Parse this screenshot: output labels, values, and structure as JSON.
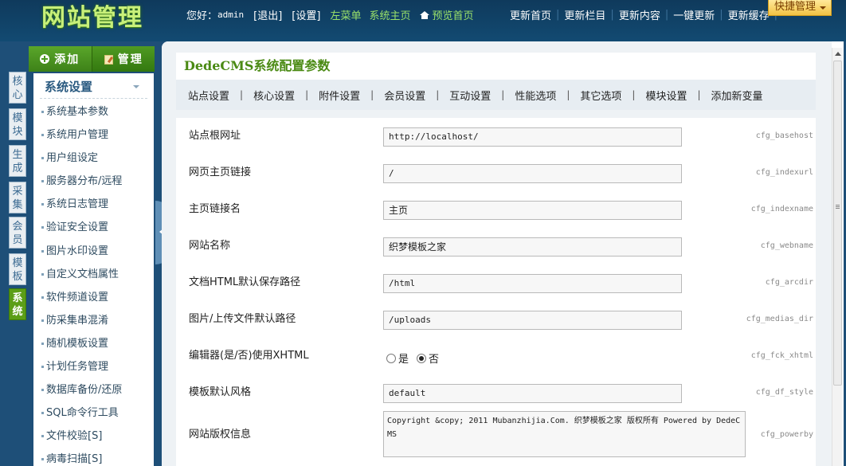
{
  "header": {
    "logo": "网站管理",
    "greeting": "您好：",
    "username": "admin",
    "logout": "[退出]",
    "settings": "[设置]",
    "left_menu": "左菜单",
    "system_home": "系统主页",
    "preview_home": "预览首页",
    "update_links": [
      "更新首页",
      "更新栏目",
      "更新内容",
      "一键更新",
      "更新缓存"
    ],
    "quick_manage": "快捷管理"
  },
  "left_tabs": [
    {
      "label": "核心",
      "active": false
    },
    {
      "label": "模块",
      "active": false
    },
    {
      "label": "生成",
      "active": false
    },
    {
      "label": "采集",
      "active": false
    },
    {
      "label": "会员",
      "active": false
    },
    {
      "label": "模板",
      "active": false
    },
    {
      "label": "系统",
      "active": true
    }
  ],
  "sidebar": {
    "add_label": "添加",
    "manage_label": "管理",
    "section_title": "系统设置",
    "items": [
      "系统基本参数",
      "系统用户管理",
      "用户组设定",
      "服务器分布/远程",
      "系统日志管理",
      "验证安全设置",
      "图片水印设置",
      "自定义文档属性",
      "软件频道设置",
      "防采集串混淆",
      "随机模板设置",
      "计划任务管理",
      "数据库备份/还原",
      "SQL命令行工具",
      "文件校验[S]",
      "病毒扫描[S]"
    ]
  },
  "main": {
    "title": "DedeCMS系统配置参数",
    "tabs": [
      "站点设置",
      "核心设置",
      "附件设置",
      "会员设置",
      "互动设置",
      "性能选项",
      "其它选项",
      "模块设置",
      "添加新变量"
    ],
    "fields": [
      {
        "label": "站点根网址",
        "value": "http://localhost/",
        "var": "cfg_basehost"
      },
      {
        "label": "网页主页链接",
        "value": "/",
        "var": "cfg_indexurl"
      },
      {
        "label": "主页链接名",
        "value": "主页",
        "var": "cfg_indexname"
      },
      {
        "label": "网站名称",
        "value": "织梦模板之家",
        "var": "cfg_webname"
      },
      {
        "label": "文档HTML默认保存路径",
        "value": "/html",
        "var": "cfg_arcdir"
      },
      {
        "label": "图片/上传文件默认路径",
        "value": "/uploads",
        "var": "cfg_medias_dir"
      },
      {
        "label": "编辑器(是/否)使用XHTML",
        "value": "否",
        "var": "cfg_fck_xhtml",
        "options": [
          "是",
          "否"
        ]
      },
      {
        "label": "模板默认风格",
        "value": "default",
        "var": "cfg_df_style"
      },
      {
        "label": "网站版权信息",
        "value": "Copyright &copy; 2011 Mubanzhijia.Com. 织梦模板之家 版权所有 Powered by DedeCMS",
        "var": "cfg_powerby"
      }
    ]
  }
}
